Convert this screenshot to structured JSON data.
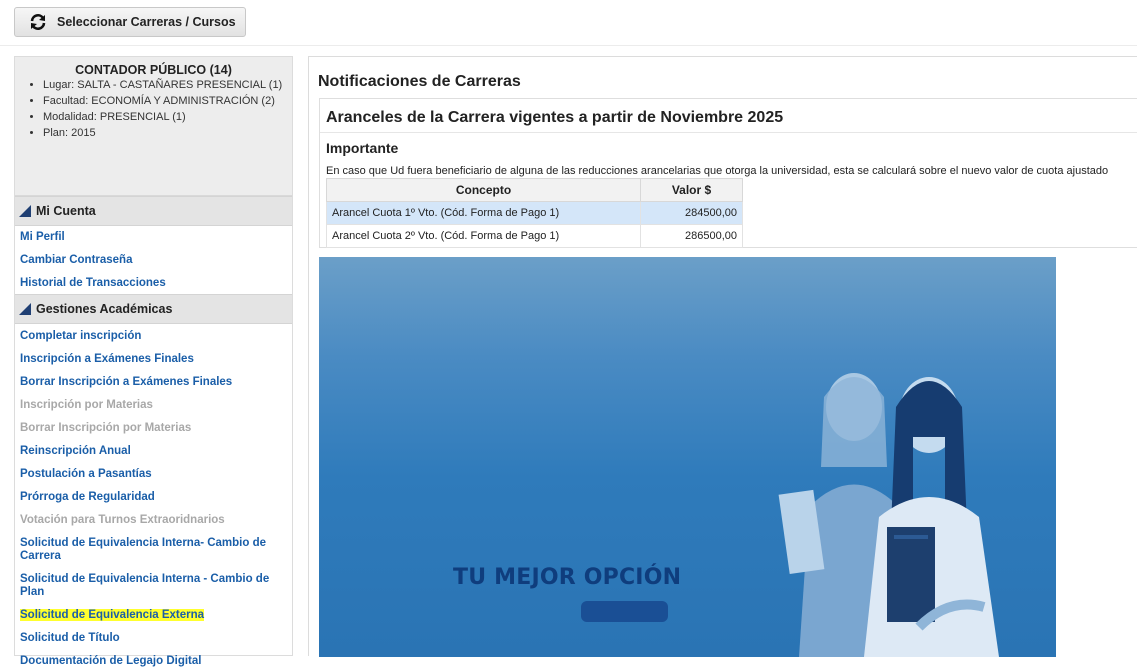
{
  "top_button": {
    "label": "Seleccionar Carreras / Cursos",
    "icon": "refresh-icon"
  },
  "career": {
    "title": "CONTADOR PÚBLICO (14)",
    "details": [
      "Lugar: SALTA - CASTAÑARES PRESENCIAL (1)",
      "Facultad: ECONOMÍA Y ADMINISTRACIÓN (2)",
      "Modalidad: PRESENCIAL (1)",
      "Plan: 2015"
    ]
  },
  "sidebar": {
    "cuenta": {
      "header": "Mi Cuenta",
      "items": [
        "Mi Perfil",
        "Cambiar Contraseña",
        "Historial de Transacciones"
      ]
    },
    "gestiones": {
      "header": "Gestiones Académicas",
      "items": [
        "Completar inscripción",
        "Inscripción a Exámenes Finales",
        "Borrar Inscripción a Exámenes Finales",
        "Inscripción por Materias",
        "Borrar Inscripción por Materias",
        "Reinscripción Anual",
        "Postulación a Pasantías",
        "Prórroga de Regularidad",
        "Votación para Turnos Extraoridnarios",
        "Solicitud de Equivalencia Interna- Cambio de Carrera",
        "Solicitud de Equivalencia Interna - Cambio de Plan",
        "Solicitud de Equivalencia Externa",
        "Solicitud de Título",
        "Documentación de Legajo Digital"
      ]
    }
  },
  "main": {
    "title": "Notificaciones de Carreras",
    "notification": {
      "title": "Aranceles de la Carrera vigentes a partir de Noviembre 2025",
      "important_label": "Importante",
      "notice": "En caso que Ud fuera beneficiario de alguna de las reducciones arancelarias que otorga la universidad, esta se calculará sobre el nuevo valor de cuota ajustado",
      "table": {
        "headers": [
          "Concepto",
          "Valor $"
        ],
        "rows": [
          [
            "Arancel Cuota 1º Vto. (Cód. Forma de Pago 1)",
            "284500,00"
          ],
          [
            "Arancel Cuota 2º Vto. (Cód. Forma de Pago 1)",
            "286500,00"
          ]
        ]
      }
    },
    "banner": {
      "headline": "TU MEJOR OPCIÓN"
    }
  },
  "colors": {
    "link": "#1a5ea8",
    "disabled_link": "#a8a8a8",
    "highlight": "#ffff2e",
    "selected_row": "#d4e6f9",
    "banner_blue": "#2f7bbb",
    "banner_text": "#0f3d7d"
  }
}
